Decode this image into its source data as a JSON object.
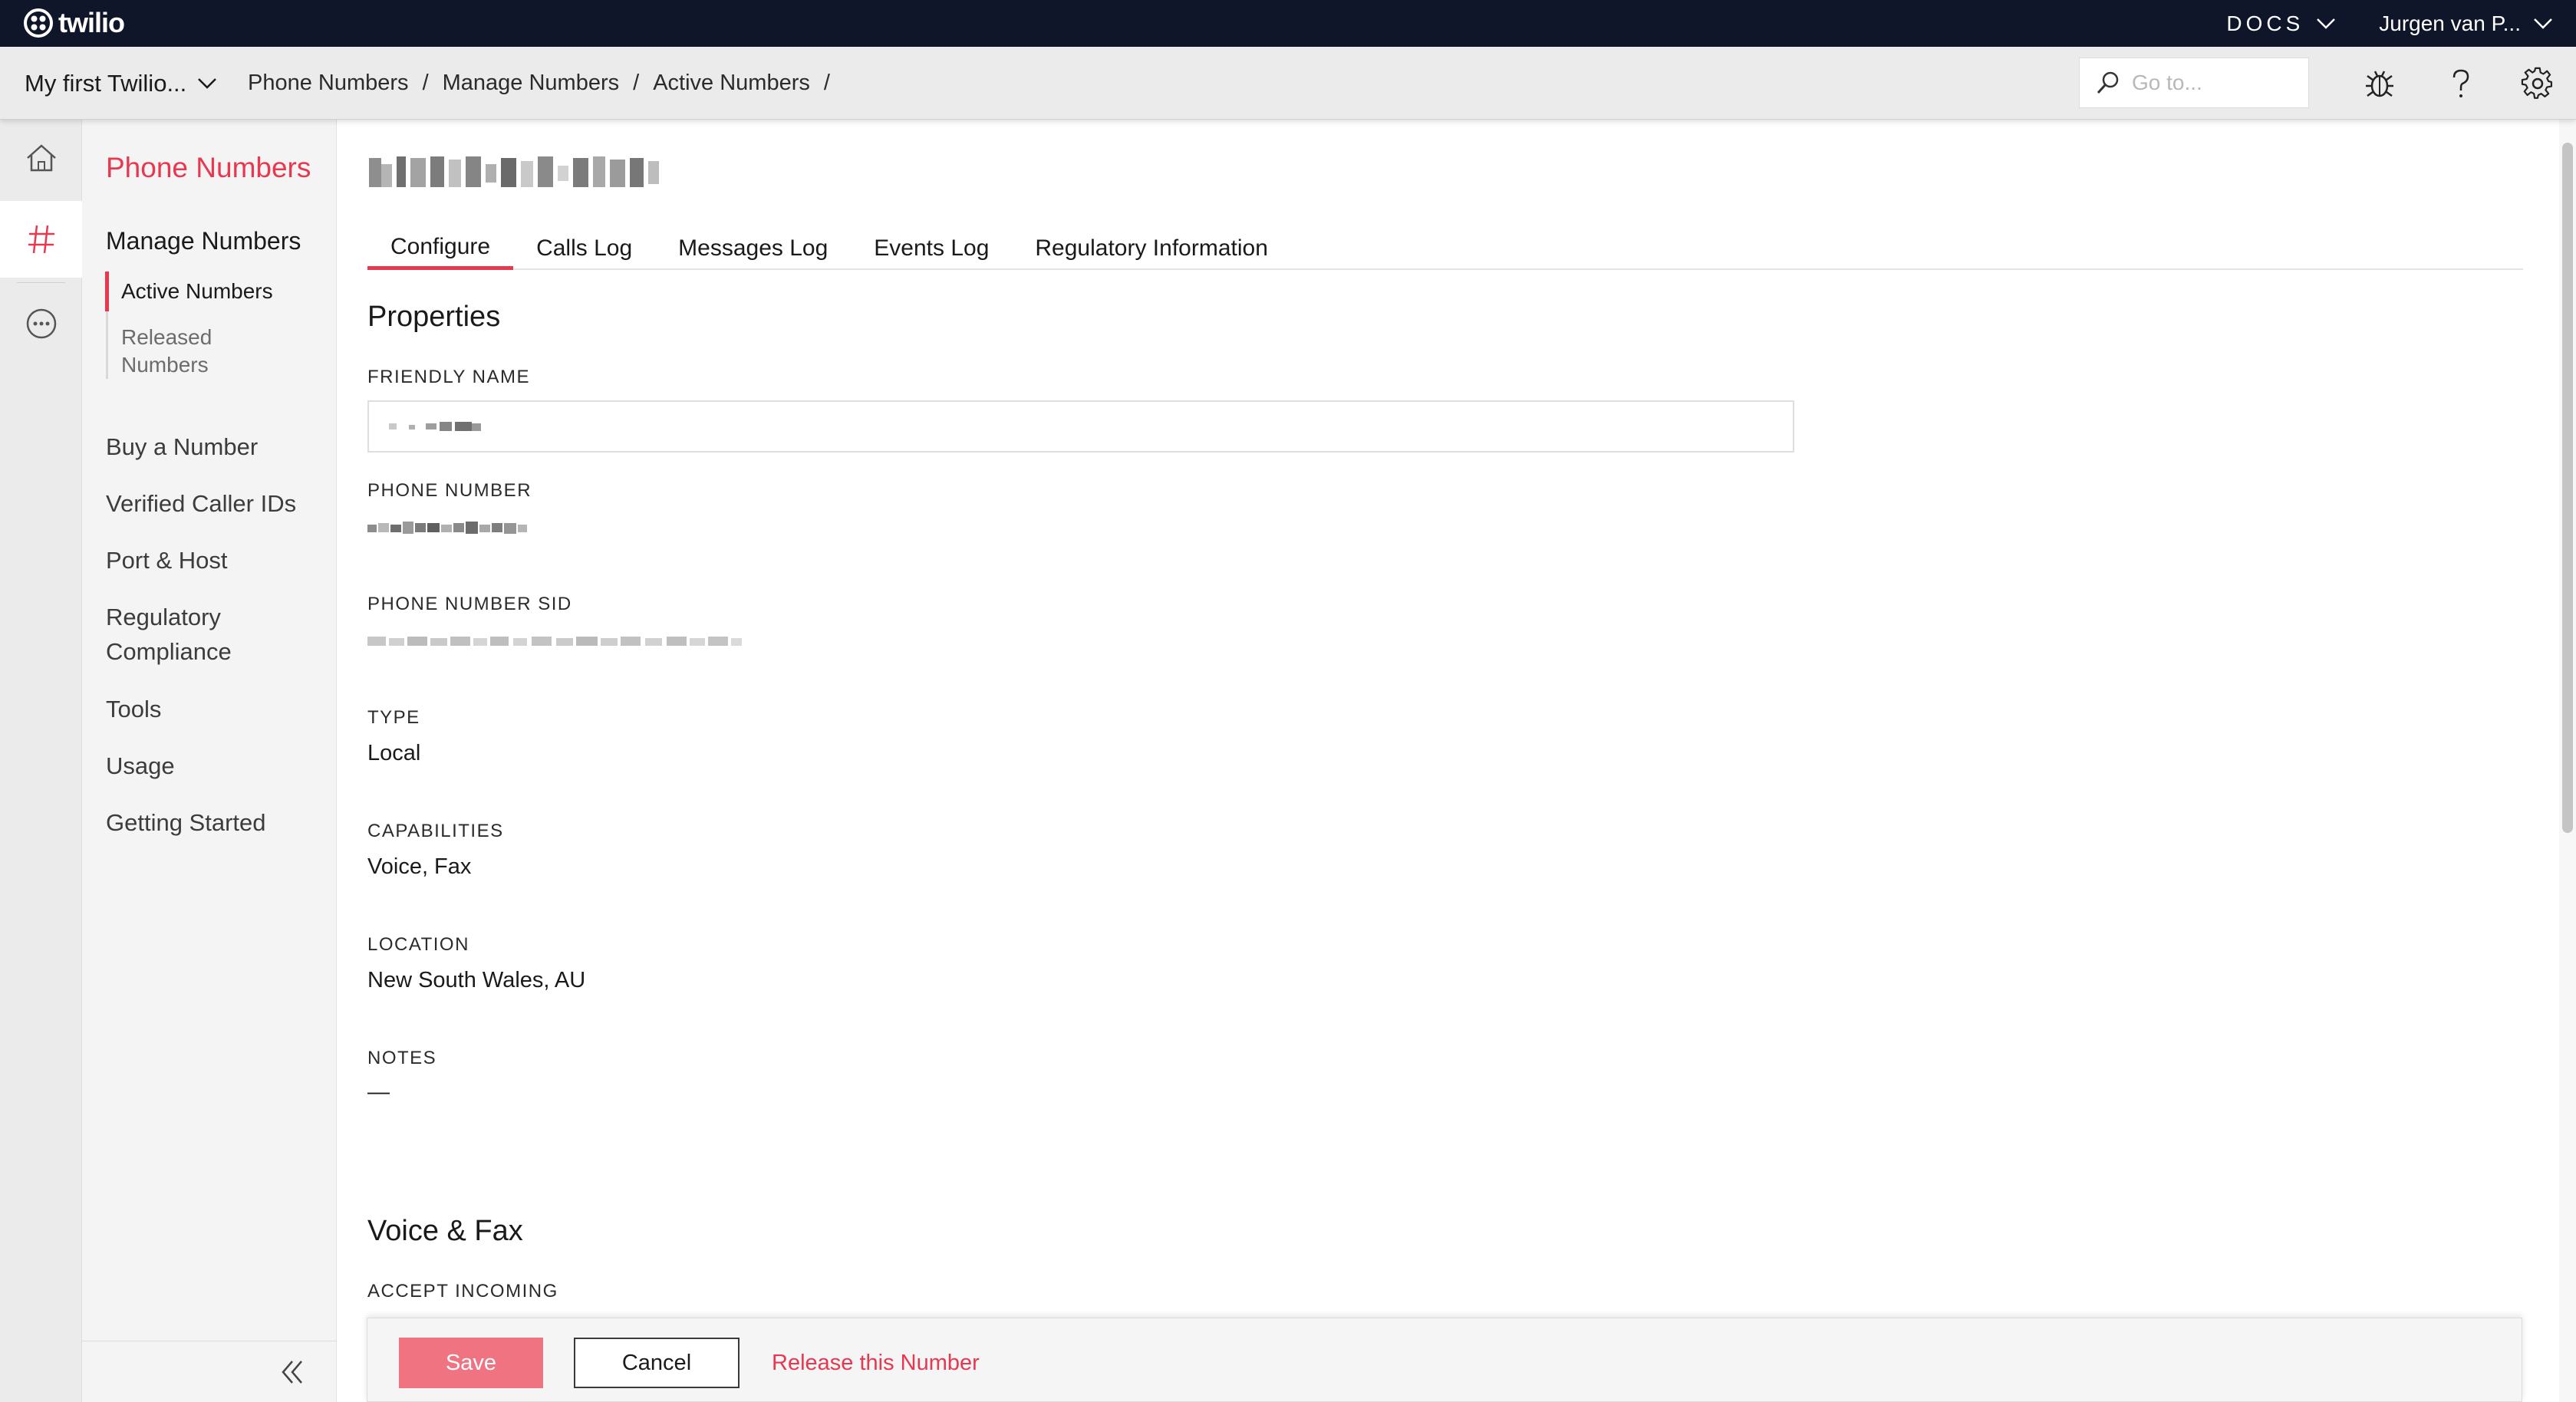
{
  "topbar": {
    "logo_text": "twilio",
    "docs_label": "DOCS",
    "user_label": "Jurgen van P..."
  },
  "crumbbar": {
    "account_label": "My first Twilio...",
    "crumbs": [
      "Phone Numbers",
      "Manage Numbers",
      "Active Numbers"
    ],
    "separator": "/",
    "search_placeholder": "Go to..."
  },
  "rail": {
    "items": [
      "home-icon",
      "hash-icon",
      "more-icon"
    ],
    "active": "hash-icon"
  },
  "sidenav": {
    "title": "Phone Numbers",
    "section": "Manage Numbers",
    "subitems": [
      {
        "label": "Active Numbers",
        "active": true
      },
      {
        "label": "Released Numbers",
        "active": false
      }
    ],
    "links": [
      "Buy a Number",
      "Verified Caller IDs",
      "Port & Host",
      "Regulatory Compliance",
      "Tools",
      "Usage",
      "Getting Started"
    ]
  },
  "main": {
    "tabs": [
      {
        "label": "Configure",
        "active": true
      },
      {
        "label": "Calls Log",
        "active": false
      },
      {
        "label": "Messages Log",
        "active": false
      },
      {
        "label": "Events Log",
        "active": false
      },
      {
        "label": "Regulatory Information",
        "active": false
      }
    ],
    "properties_heading": "Properties",
    "fields": {
      "friendly_name_label": "FRIENDLY NAME",
      "phone_number_label": "PHONE NUMBER",
      "phone_number_sid_label": "PHONE NUMBER SID",
      "type_label": "TYPE",
      "type_value": "Local",
      "capabilities_label": "CAPABILITIES",
      "capabilities_value": "Voice, Fax",
      "location_label": "LOCATION",
      "location_value": "New South Wales, AU",
      "notes_label": "NOTES",
      "notes_value": "—"
    },
    "voice_heading": "Voice & Fax",
    "accept_incoming_label": "ACCEPT INCOMING"
  },
  "actions": {
    "save_label": "Save",
    "cancel_label": "Cancel",
    "release_label": "Release this Number"
  },
  "colors": {
    "accent": "#e8384f",
    "save_bg": "#f07381",
    "topbar_bg": "#0f1629"
  }
}
